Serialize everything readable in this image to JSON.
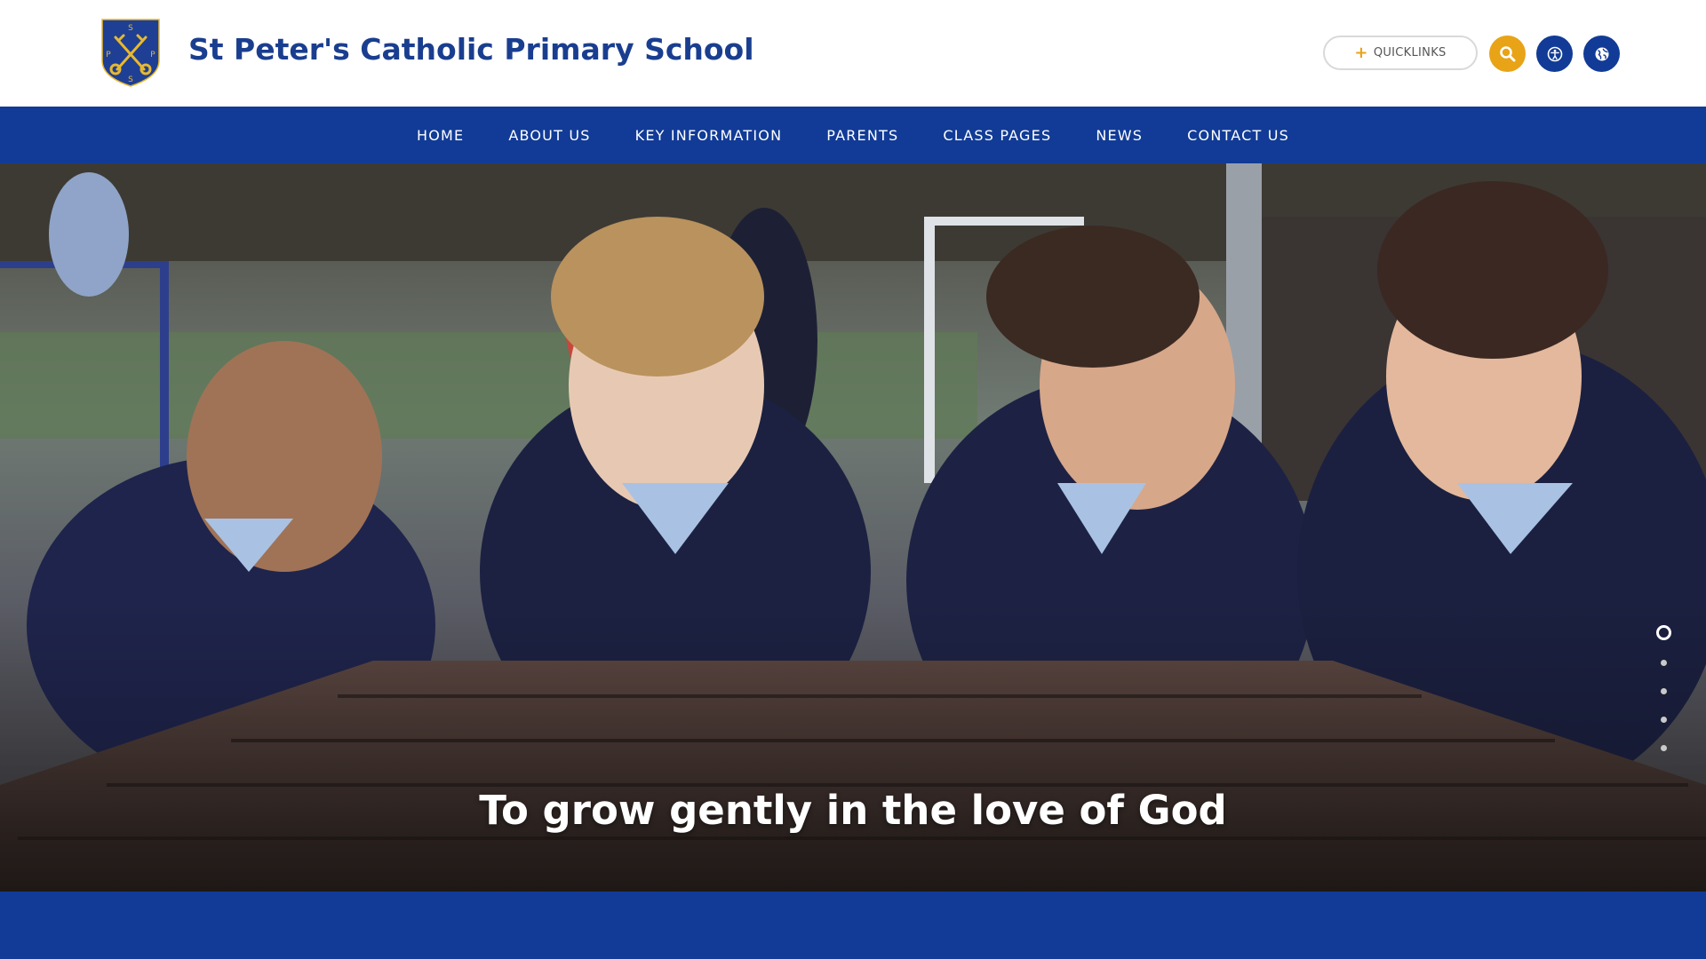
{
  "header": {
    "school_name": "St Peter's Catholic Primary School",
    "logo_letters": [
      "S",
      "P",
      "P",
      "S"
    ],
    "quicklinks_label": "QUICKLINKS",
    "buttons": {
      "search": "search-icon",
      "accessibility": "accessibility-icon",
      "translate": "globe-icon"
    }
  },
  "nav": {
    "items": [
      {
        "label": "HOME"
      },
      {
        "label": "ABOUT US"
      },
      {
        "label": "KEY INFORMATION"
      },
      {
        "label": "PARENTS"
      },
      {
        "label": "CLASS PAGES"
      },
      {
        "label": "NEWS"
      },
      {
        "label": "CONTACT US"
      }
    ]
  },
  "hero": {
    "caption": "To grow gently in the love of God",
    "slides_total": 5,
    "active_slide": 1
  },
  "colors": {
    "brand_blue": "#113b96",
    "accent_gold": "#e8a317",
    "title_blue": "#1a3e8f"
  }
}
